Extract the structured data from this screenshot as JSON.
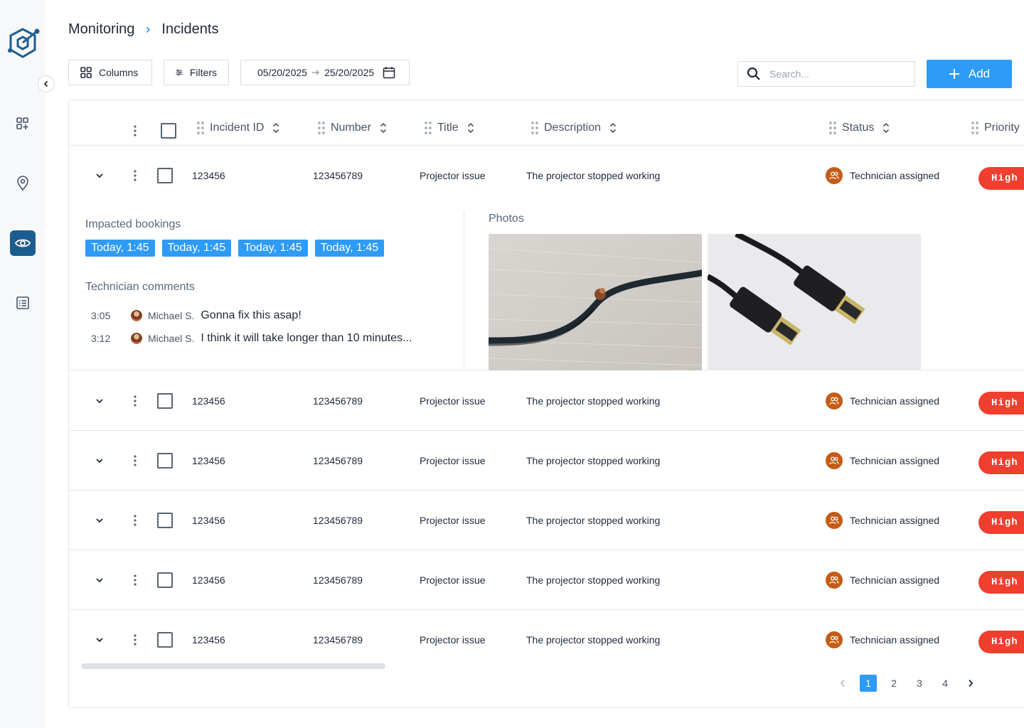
{
  "breadcrumb": {
    "parent": "Monitoring",
    "current": "Incidents"
  },
  "toolbar": {
    "columns_label": "Columns",
    "filters_label": "Filters",
    "date_from": "05/20/2025",
    "date_to": "25/20/2025",
    "search_placeholder": "Search...",
    "add_label": "Add"
  },
  "columns": [
    "Incident ID",
    "Number",
    "Title",
    "Description",
    "Status",
    "Priority"
  ],
  "rows": [
    {
      "incident_id": "123456",
      "number": "123456789",
      "title": "Projector issue",
      "description": "The projector stopped working",
      "status": "Technician assigned",
      "priority": "High"
    },
    {
      "incident_id": "123456",
      "number": "123456789",
      "title": "Projector issue",
      "description": "The projector stopped working",
      "status": "Technician assigned",
      "priority": "High"
    },
    {
      "incident_id": "123456",
      "number": "123456789",
      "title": "Projector issue",
      "description": "The projector stopped working",
      "status": "Technician assigned",
      "priority": "High"
    },
    {
      "incident_id": "123456",
      "number": "123456789",
      "title": "Projector issue",
      "description": "The projector stopped working",
      "status": "Technician assigned",
      "priority": "High"
    },
    {
      "incident_id": "123456",
      "number": "123456789",
      "title": "Projector issue",
      "description": "The projector stopped working",
      "status": "Technician assigned",
      "priority": "High"
    },
    {
      "incident_id": "123456",
      "number": "123456789",
      "title": "Projector issue",
      "description": "The projector stopped working",
      "status": "Technician assigned",
      "priority": "High"
    }
  ],
  "expanded": {
    "impacted_label": "Impacted bookings",
    "bookings": [
      "Today, 1:45",
      "Today, 1:45",
      "Today, 1:45",
      "Today, 1:45"
    ],
    "comments_label": "Technician comments",
    "comments": [
      {
        "time": "3:05",
        "author": "Michael S.",
        "text": "Gonna fix this asap!"
      },
      {
        "time": "3:12",
        "author": "Michael S.",
        "text": "I think it will take longer than 10 minutes..."
      }
    ],
    "photos_label": "Photos"
  },
  "pagination": {
    "pages": [
      "1",
      "2",
      "3",
      "4"
    ],
    "current": "1"
  },
  "colors": {
    "accent": "#2e9bf6",
    "nav_active": "#1c5d8f",
    "priority_high": "#f03e2f",
    "status": "#c45c16"
  },
  "icons": {
    "sidebar": [
      "dashboard-icon",
      "location-pin-icon",
      "eye-icon",
      "list-icon"
    ],
    "toolbar": [
      "columns-grid-icon",
      "filter-sliders-icon",
      "calendar-icon",
      "search-icon",
      "plus-icon"
    ]
  }
}
